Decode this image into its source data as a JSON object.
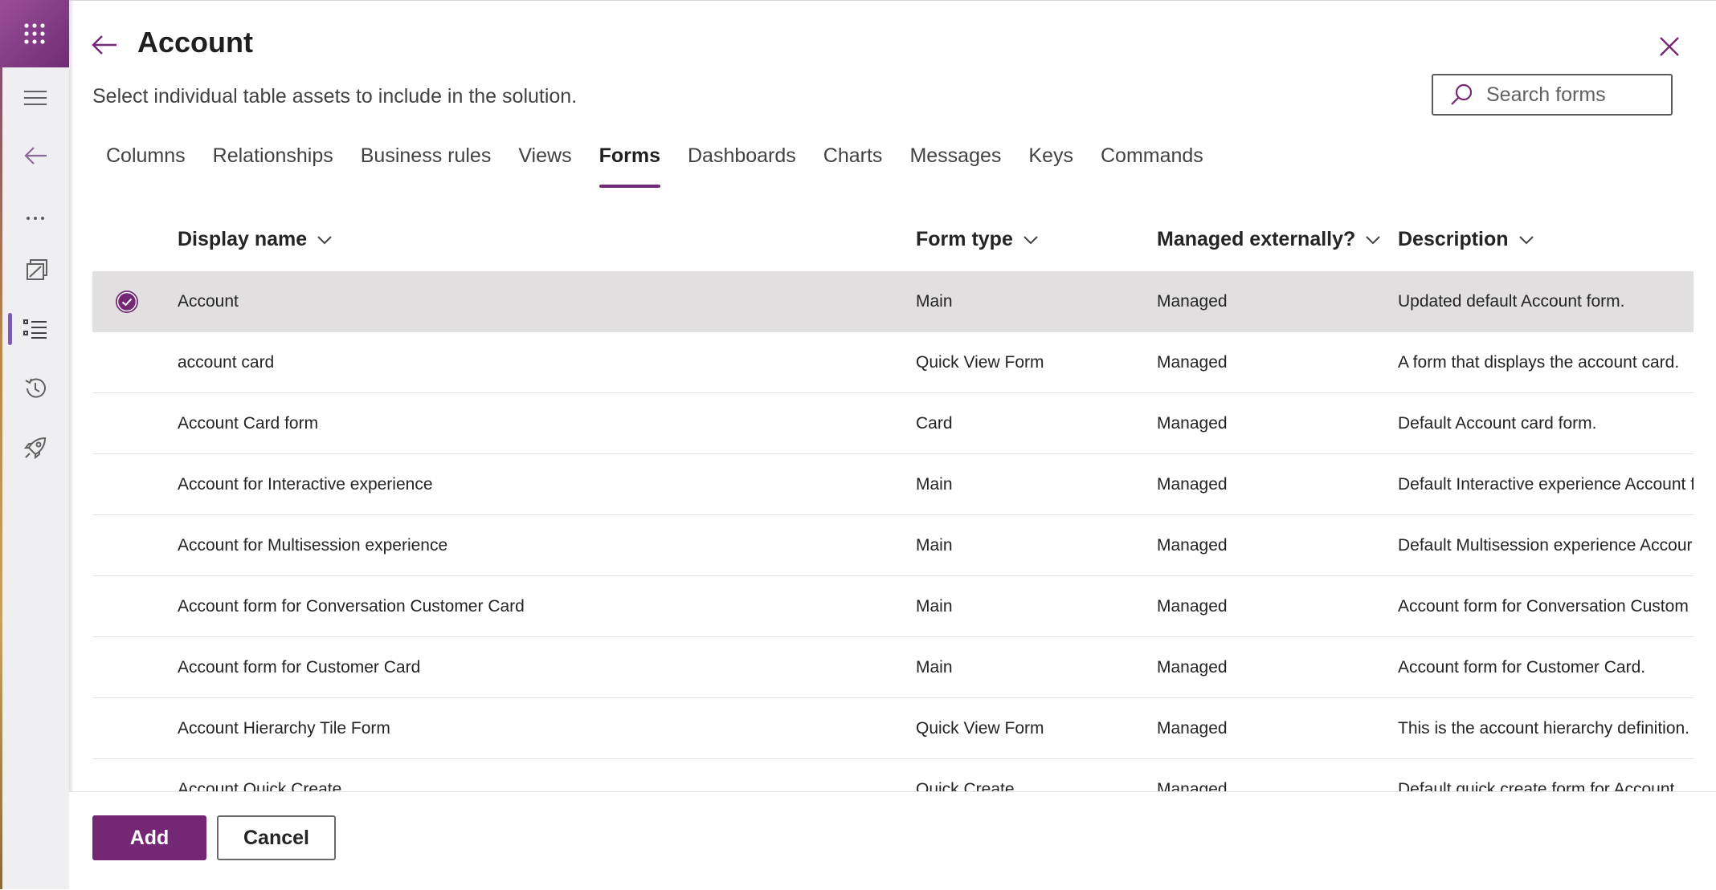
{
  "panel": {
    "title": "Account",
    "subtitle": "Select individual table assets to include in the solution.",
    "back_icon": "arrow-left-icon",
    "close_icon": "close-icon"
  },
  "search": {
    "placeholder": "Search forms",
    "value": ""
  },
  "tabs": [
    {
      "label": "Columns",
      "active": false
    },
    {
      "label": "Relationships",
      "active": false
    },
    {
      "label": "Business rules",
      "active": false
    },
    {
      "label": "Views",
      "active": false
    },
    {
      "label": "Forms",
      "active": true
    },
    {
      "label": "Dashboards",
      "active": false
    },
    {
      "label": "Charts",
      "active": false
    },
    {
      "label": "Messages",
      "active": false
    },
    {
      "label": "Keys",
      "active": false
    },
    {
      "label": "Commands",
      "active": false
    }
  ],
  "table": {
    "headers": {
      "display_name": "Display name",
      "form_type": "Form type",
      "managed": "Managed externally?",
      "description": "Description"
    },
    "rows": [
      {
        "name": "Account",
        "type": "Main",
        "managed": "Managed",
        "description": "Updated default Account form.",
        "selected": true
      },
      {
        "name": "account card",
        "type": "Quick View Form",
        "managed": "Managed",
        "description": "A form that displays the account card.",
        "selected": false
      },
      {
        "name": "Account Card form",
        "type": "Card",
        "managed": "Managed",
        "description": "Default Account card form.",
        "selected": false
      },
      {
        "name": "Account for Interactive experience",
        "type": "Main",
        "managed": "Managed",
        "description": "Default Interactive experience Account f",
        "selected": false
      },
      {
        "name": "Account for Multisession experience",
        "type": "Main",
        "managed": "Managed",
        "description": "Default Multisession experience Accour",
        "selected": false
      },
      {
        "name": "Account form for Conversation Customer Card",
        "type": "Main",
        "managed": "Managed",
        "description": "Account form for Conversation Custom",
        "selected": false
      },
      {
        "name": "Account form for Customer Card",
        "type": "Main",
        "managed": "Managed",
        "description": "Account form for Customer Card.",
        "selected": false
      },
      {
        "name": "Account Hierarchy Tile Form",
        "type": "Quick View Form",
        "managed": "Managed",
        "description": "This is the account hierarchy definition.",
        "selected": false
      },
      {
        "name": "Account Quick Create",
        "type": "Quick Create",
        "managed": "Managed",
        "description": "Default quick create form for Account",
        "selected": false
      }
    ]
  },
  "footer": {
    "add_label": "Add",
    "cancel_label": "Cancel"
  },
  "rail": {
    "icons": [
      "waffle-icon",
      "hamburger-icon",
      "arrow-left-icon",
      "more-icon",
      "objects-icon",
      "list-icon",
      "history-icon",
      "rocket-icon"
    ]
  },
  "colors": {
    "accent": "#742774",
    "selected_row": "#e1dfe0",
    "rail_bg": "#efeff1"
  }
}
